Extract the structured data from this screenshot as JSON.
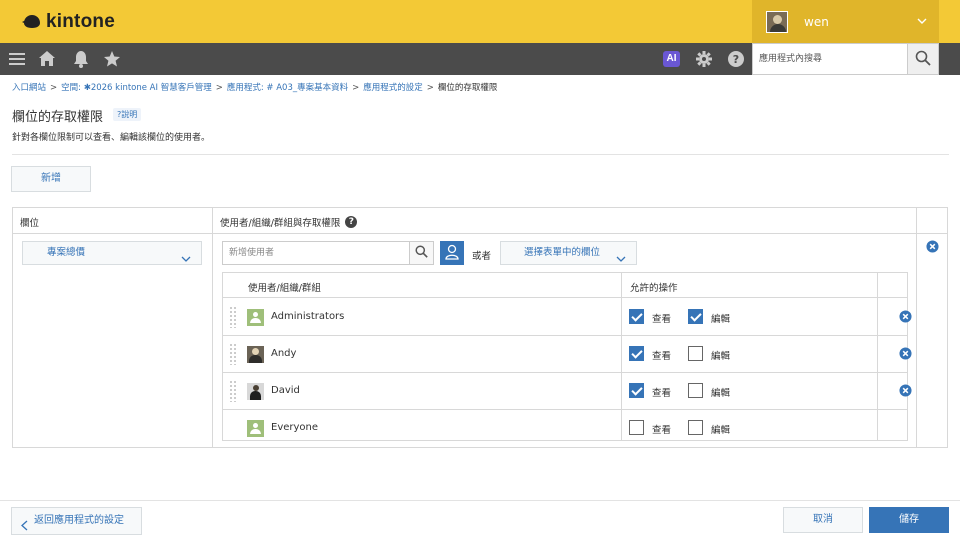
{
  "app": {
    "logo_text": "kintone"
  },
  "user": {
    "name": "wen"
  },
  "nav": {
    "search_placeholder": "應用程式內搜尋",
    "ai_label": "AI"
  },
  "breadcrumb": [
    "入口網站",
    "空間: ✱2026 kintone AI 智慧客戶管理",
    "應用程式: # A03_專案基本資料",
    "應用程式的設定",
    "欄位的存取權限"
  ],
  "page": {
    "title": "欄位的存取權限",
    "help_label": "?說明",
    "subtitle": "針對各欄位限制可以查看、編輯該欄位的使用者。",
    "add_button": "新增"
  },
  "table": {
    "header_field": "欄位",
    "header_permissions": "使用者/組織/群組與存取權限",
    "field_value": "專案總價",
    "user_input_placeholder": "新增使用者",
    "or_text": "或者",
    "form_field_select": "選擇表單中的欄位",
    "perm_header_entity": "使用者/組織/群組",
    "perm_header_actions": "允許的操作",
    "view_label": "查看",
    "edit_label": "編輯",
    "rows": [
      {
        "name": "Administrators",
        "type": "group",
        "view": true,
        "edit": true,
        "removable": true,
        "draggable": true
      },
      {
        "name": "Andy",
        "type": "user",
        "view": true,
        "edit": false,
        "removable": true,
        "draggable": true
      },
      {
        "name": "David",
        "type": "user",
        "view": true,
        "edit": false,
        "removable": true,
        "draggable": true
      },
      {
        "name": "Everyone",
        "type": "group",
        "view": false,
        "edit": false,
        "removable": false,
        "draggable": false
      }
    ]
  },
  "footer": {
    "back_button": "返回應用程式的設定",
    "cancel_button": "取消",
    "save_button": "儲存"
  },
  "colors": {
    "brand_yellow": "#f3c936",
    "nav_dark": "#4b4b4b",
    "accent_blue": "#3674b7",
    "ai_purple": "#6a57d4"
  }
}
